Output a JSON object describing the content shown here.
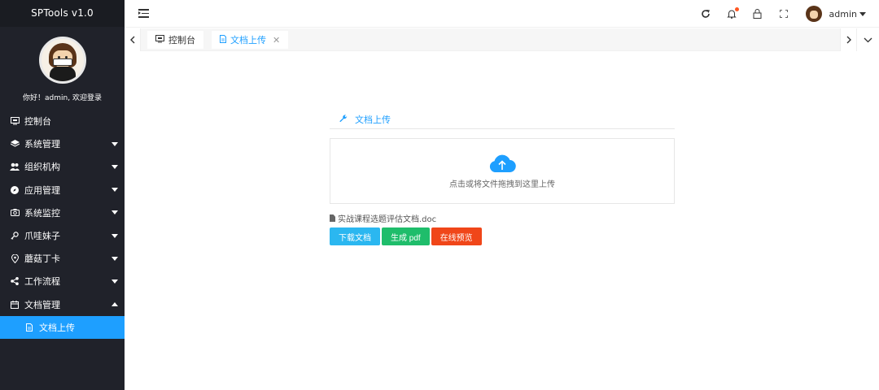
{
  "app": {
    "title": "SPTools v1.0"
  },
  "sidebar": {
    "welcome": "你好！admin, 欢迎登录",
    "items": [
      {
        "label": "控制台",
        "icon": "monitor-icon"
      },
      {
        "label": "系统管理",
        "icon": "layers-icon"
      },
      {
        "label": "组织机构",
        "icon": "users-icon"
      },
      {
        "label": "应用管理",
        "icon": "compass-icon"
      },
      {
        "label": "系统监控",
        "icon": "camera-icon"
      },
      {
        "label": "爪哇妹子",
        "icon": "key-icon"
      },
      {
        "label": "蘑菇丁卡",
        "icon": "location-icon"
      },
      {
        "label": "工作流程",
        "icon": "share-icon"
      },
      {
        "label": "文档管理",
        "icon": "calendar-icon"
      }
    ],
    "sub_item": {
      "label": "文档上传",
      "icon": "document-icon"
    }
  },
  "header": {
    "user_name": "admin",
    "notification_dot_color": "#ff5722"
  },
  "tabs": [
    {
      "label": "控制台",
      "icon": "monitor-icon"
    },
    {
      "label": "文档上传",
      "icon": "document-icon",
      "active": true
    }
  ],
  "upload": {
    "panel_title": "文档上传",
    "dropzone_text": "点击或将文件拖拽到这里上传",
    "file_name": "实战课程选题评估文档.doc",
    "buttons": {
      "download": "下载文档",
      "generate_pdf": "生成 pdf",
      "preview": "在线预览"
    }
  },
  "colors": {
    "accent": "#1e9fff",
    "sidebar_bg": "#20222a",
    "download_btn": "#2bb7f0",
    "pdf_btn": "#1fbd6b",
    "preview_btn": "#f04619"
  }
}
